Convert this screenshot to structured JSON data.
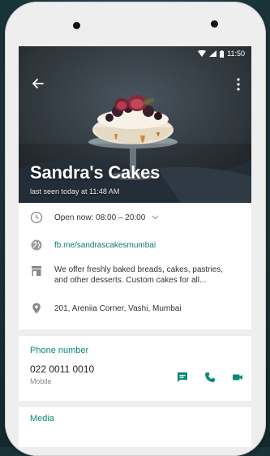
{
  "status_bar": {
    "time": "11:50"
  },
  "profile": {
    "name": "Sandra's Cakes",
    "last_seen": "last seen today at 11:48 AM"
  },
  "info": {
    "hours": "Open now: 08:00 – 20:00",
    "website": "fb.me/sandrascakesmumbai",
    "description_line1": "We offer freshly baked breads, cakes, pastries,",
    "description_line2": "and other desserts. Custom cakes for all...",
    "address": "201, Areniia Corner, Vashi, Mumbai"
  },
  "phone": {
    "section_title": "Phone number",
    "number": "022 0011 0010",
    "type": "Mobile"
  },
  "next_section": {
    "title": "Media"
  },
  "icons": {
    "back": "arrow-left-icon",
    "menu": "more-vert-icon",
    "hours": "clock-icon",
    "website": "globe-icon",
    "description": "store-icon",
    "address": "location-pin-icon",
    "message": "message-icon",
    "call": "phone-icon",
    "video": "video-icon"
  },
  "colors": {
    "accent": "#0a8a7a",
    "link": "#0a7a6f"
  }
}
